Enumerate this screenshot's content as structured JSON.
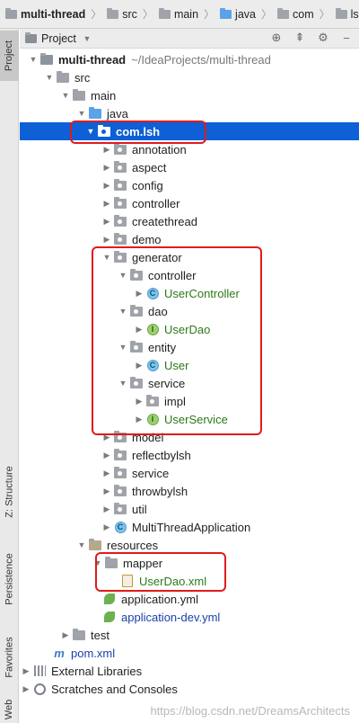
{
  "breadcrumb": [
    "multi-thread",
    "src",
    "main",
    "java",
    "com",
    "lsh"
  ],
  "toolstrip": {
    "project": "Project",
    "structure": "Z: Structure",
    "persistence": "Persistence",
    "favorites": "Favorites",
    "web": "Web"
  },
  "panel": {
    "title": "Project"
  },
  "tree": {
    "root": {
      "name": "multi-thread",
      "path": "~/IdeaProjects/multi-thread"
    },
    "src": "src",
    "main": "main",
    "java": "java",
    "com_lsh": "com.lsh",
    "annotation": "annotation",
    "aspect": "aspect",
    "config": "config",
    "controller": "controller",
    "createthread": "createthread",
    "demo": "demo",
    "generator": "generator",
    "gen_controller": "controller",
    "user_controller": "UserController",
    "dao": "dao",
    "user_dao": "UserDao",
    "entity": "entity",
    "user": "User",
    "service": "service",
    "impl": "impl",
    "user_service": "UserService",
    "model": "model",
    "reflectbylsh": "reflectbylsh",
    "service2": "service",
    "throwbylsh": "throwbylsh",
    "util": "util",
    "app": "MultiThreadApplication",
    "resources": "resources",
    "mapper": "mapper",
    "userdao_xml": "UserDao.xml",
    "app_yml": "application.yml",
    "app_dev_yml": "application-dev.yml",
    "test": "test",
    "pom": "pom.xml",
    "ext_libs": "External Libraries",
    "scratches": "Scratches and Consoles"
  },
  "watermark": "https://blog.csdn.net/DreamsArchitects",
  "colors": {
    "selection": "#0d60d6",
    "highlight": "#e01b1b",
    "class_green": "#2a7a18"
  }
}
